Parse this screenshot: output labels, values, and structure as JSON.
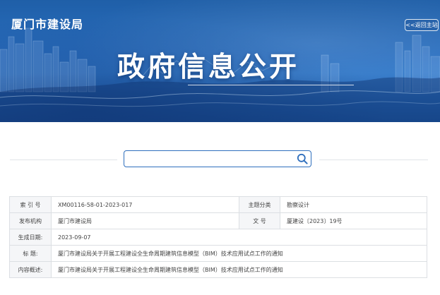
{
  "header": {
    "site_name": "厦门市建设局",
    "back_button": "<<返回主站",
    "banner_title": "政府信息公开"
  },
  "search": {
    "placeholder": "",
    "value": "",
    "icon": "search-icon"
  },
  "info_table": {
    "index_label": "索 引 号",
    "index_value": "XM00116-58-01-2023-017",
    "category_label": "主题分类",
    "category_value": "勘察设计",
    "publisher_label": "发布机构",
    "publisher_value": "厦门市建设局",
    "doc_no_label": "文 号",
    "doc_no_value": "厦建设〔2023〕19号",
    "date_label": "生成日期:",
    "date_value": "2023-09-07",
    "title_label": "标 题:",
    "title_value": "厦门市建设局关于开展工程建设全生命周期建筑信息模型（BIM）技术应用试点工作的通知",
    "summary_label": "内容概述:",
    "summary_value": "厦门市建设局关于开展工程建设全生命周期建筑信息模型（BIM）技术应用试点工作的通知"
  },
  "colors": {
    "banner_blue": "#1f5fa8",
    "search_border": "#2f6fbd",
    "table_border": "#dcdfe3",
    "label_bg": "#f5f6f8"
  }
}
